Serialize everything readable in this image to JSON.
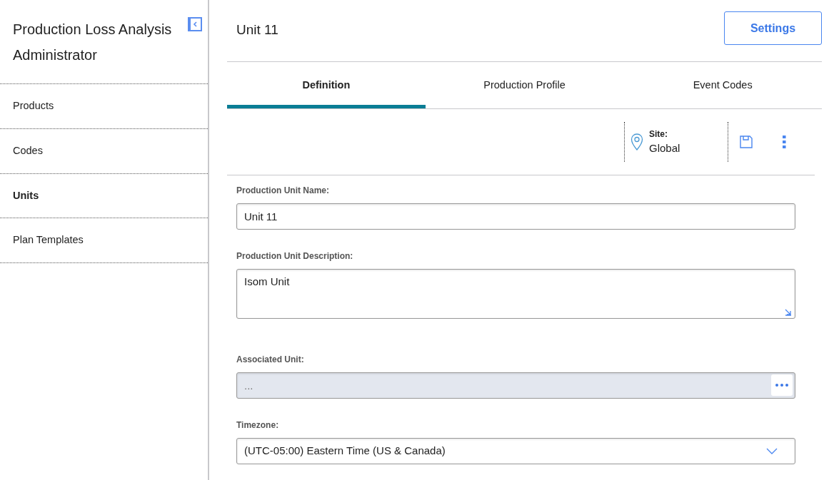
{
  "sidebar": {
    "title": "Production Loss Analysis Administrator",
    "items": [
      {
        "label": "Products",
        "selected": false
      },
      {
        "label": "Codes",
        "selected": false
      },
      {
        "label": "Units",
        "selected": true
      },
      {
        "label": "Plan Templates",
        "selected": false
      }
    ]
  },
  "header": {
    "title": "Unit 11",
    "button": "Settings"
  },
  "tabs": [
    {
      "label": "Definition",
      "selected": true
    },
    {
      "label": "Production Profile",
      "selected": false
    },
    {
      "label": "Event Codes",
      "selected": false
    }
  ],
  "toolbar": {
    "site_label": "Site:",
    "site_value": "Global"
  },
  "fields": [
    {
      "kind": "text",
      "label": "Production Unit Name:",
      "value": "Unit 11"
    },
    {
      "kind": "textarea",
      "label": "Production Unit Description:",
      "value": "Isom Unit"
    },
    {
      "kind": "lookup",
      "label": "Associated Unit:",
      "placeholder": "...",
      "disabled": true
    },
    {
      "kind": "select",
      "label": "Timezone:",
      "value": "(UTC-05:00) Eastern Time (US & Canada)"
    }
  ]
}
